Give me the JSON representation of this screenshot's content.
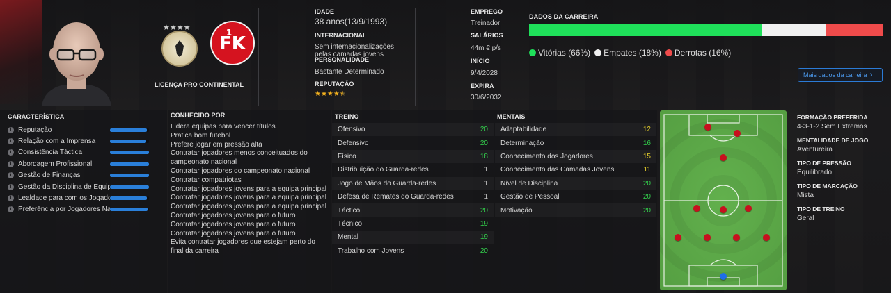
{
  "profile": {
    "license": "LICENÇA PRO CONTINENTAL",
    "age_label": "IDADE",
    "age_value": "38 anos(13/9/1993)",
    "international_label": "INTERNACIONAL",
    "international_value": "Sem internacionalizações pelas camadas jovens",
    "personality_label": "PERSONALIDADE",
    "personality_value": "Bastante Determinado",
    "reputation_label": "REPUTAÇÃO",
    "reputation_stars": "★★★★★",
    "reputation_value": 4.5,
    "job_label": "EMPREGO",
    "job_value": "Treinador",
    "salary_label": "SALÁRIOS",
    "salary_value": "44m € p/s",
    "start_label": "INÍCIO",
    "start_value": "9/4/2028",
    "expiry_label": "EXPIRA",
    "expiry_value": "30/6/2032"
  },
  "career": {
    "title": "DADOS DA CARREIRA",
    "wins_label": "Vitórias (66%)",
    "draws_label": "Empates (18%)",
    "losses_label": "Derrotas (16%)",
    "wins_pct": 66,
    "draws_pct": 18,
    "losses_pct": 16,
    "colors": {
      "wins": "#1fe05a",
      "draws": "#f0f0f0",
      "losses": "#ef4b4b"
    },
    "more_button": "Mais dados da carreira"
  },
  "characteristics": {
    "title": "CARACTERÍSTICA",
    "items": [
      {
        "label": "Reputação",
        "level": 0.95
      },
      {
        "label": "Relação com a Imprensa",
        "level": 0.92
      },
      {
        "label": "Consistência Táctica",
        "level": 1.0
      },
      {
        "label": "Abordagem Profissional",
        "level": 1.0
      },
      {
        "label": "Gestão de Finanças",
        "level": 1.0
      },
      {
        "label": "Gestão da Disciplina de Equipa",
        "level": 1.0
      },
      {
        "label": "Lealdade para com os Jogadores",
        "level": 0.95
      },
      {
        "label": "Preferência por Jogadores Na...",
        "level": 0.97
      }
    ]
  },
  "known_for": {
    "title": "CONHECIDO POR",
    "items": [
      "Lidera equipas para vencer títulos",
      "Pratica bom futebol",
      "Prefere jogar em pressão alta",
      "Contratar jogadores menos conceituados do campeonato nacional",
      "Contratar jogadores do campeonato nacional",
      "Contratar compatriotas",
      "Contratar jogadores jovens para a equipa principal",
      "Contratar jogadores jovens para a equipa principal",
      "Contratar jogadores jovens para a equipa principal",
      "Contratar jogadores jovens para o futuro",
      "Contratar jogadores jovens para o futuro",
      "Contratar jogadores jovens para o futuro",
      "Evita contratar jogadores que estejam perto do final da carreira"
    ]
  },
  "training": {
    "title": "TREINO",
    "items": [
      {
        "label": "Ofensivo",
        "value": "20",
        "tone": "green"
      },
      {
        "label": "Defensivo",
        "value": "20",
        "tone": "green"
      },
      {
        "label": "Físico",
        "value": "18",
        "tone": "green"
      },
      {
        "label": "Distribuição do Guarda-redes",
        "value": "1",
        "tone": "gray"
      },
      {
        "label": "Jogo de Mãos do Guarda-redes",
        "value": "1",
        "tone": "gray"
      },
      {
        "label": "Defesa de Remates do Guarda-redes",
        "value": "1",
        "tone": "gray"
      },
      {
        "label": "Táctico",
        "value": "20",
        "tone": "green"
      },
      {
        "label": "Técnico",
        "value": "19",
        "tone": "green"
      },
      {
        "label": "Mental",
        "value": "19",
        "tone": "green"
      },
      {
        "label": "Trabalho com Jovens",
        "value": "20",
        "tone": "green"
      }
    ]
  },
  "mental": {
    "title": "MENTAIS",
    "items": [
      {
        "label": "Adaptabilidade",
        "value": "12",
        "tone": "yellow"
      },
      {
        "label": "Determinação",
        "value": "16",
        "tone": "green"
      },
      {
        "label": "Conhecimento dos Jogadores",
        "value": "15",
        "tone": "yellow"
      },
      {
        "label": "Conhecimento das Camadas Jovens",
        "value": "11",
        "tone": "yellow"
      },
      {
        "label": "Nível de Disciplina",
        "value": "20",
        "tone": "green"
      },
      {
        "label": "Gestão de Pessoal",
        "value": "20",
        "tone": "green"
      },
      {
        "label": "Motivação",
        "value": "20",
        "tone": "green"
      }
    ]
  },
  "tactics": {
    "formation_label": "FORMAÇÃO PREFERIDA",
    "formation_value": "4-3-1-2 Sem Extremos",
    "mentality_label": "MENTALIDADE DE JOGO",
    "mentality_value": "Aventureira",
    "pressing_label": "TIPO DE PRESSÃO",
    "pressing_value": "Equilibrado",
    "marking_label": "TIPO DE MARCAÇÃO",
    "marking_value": "Mista",
    "training_type_label": "TIPO DE TREINO",
    "training_type_value": "Geral"
  },
  "colors": {
    "accent_blue": "#2a7fd9",
    "pitch_light": "#5fae4a",
    "pitch_dark": "#54a241",
    "player_red": "#c8101e",
    "keeper_blue": "#1e6ee8"
  },
  "icons": {
    "info": "info-icon",
    "chevron": "chevron-right-icon"
  }
}
